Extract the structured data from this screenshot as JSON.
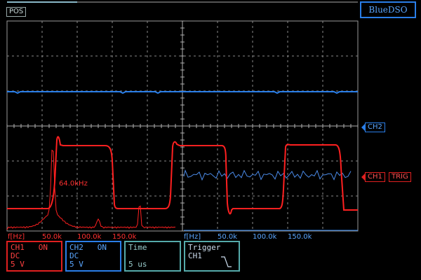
{
  "header": {
    "pos_label": "POS",
    "brand": "BlueDSO",
    "progress": 0.2
  },
  "markers": {
    "ch2": "CH2",
    "ch1": "CH1",
    "trig": "TRIG"
  },
  "measurements": {
    "ch1_freq": "64.0kHz"
  },
  "fft_axis": {
    "unit_label": "f[Hz]",
    "ch1_ticks": [
      "50.0k",
      "100.0k",
      "150.0k"
    ],
    "ch2_ticks": [
      "50.0k",
      "100.0k",
      "150.0k"
    ]
  },
  "panels": {
    "ch1": {
      "name": "CH1",
      "state": "ON",
      "coupling": "DC",
      "scale": "5 V"
    },
    "ch2": {
      "name": "CH2",
      "state": "ON",
      "coupling": "DC",
      "scale": "5 V"
    },
    "time": {
      "title": "Time",
      "value": "5 us"
    },
    "trigger": {
      "title": "Trigger",
      "source": "CH1"
    }
  },
  "colors": {
    "ch1": "#ff2020",
    "ch2": "#2a7ee8",
    "grid": "#8a8a8a"
  }
}
